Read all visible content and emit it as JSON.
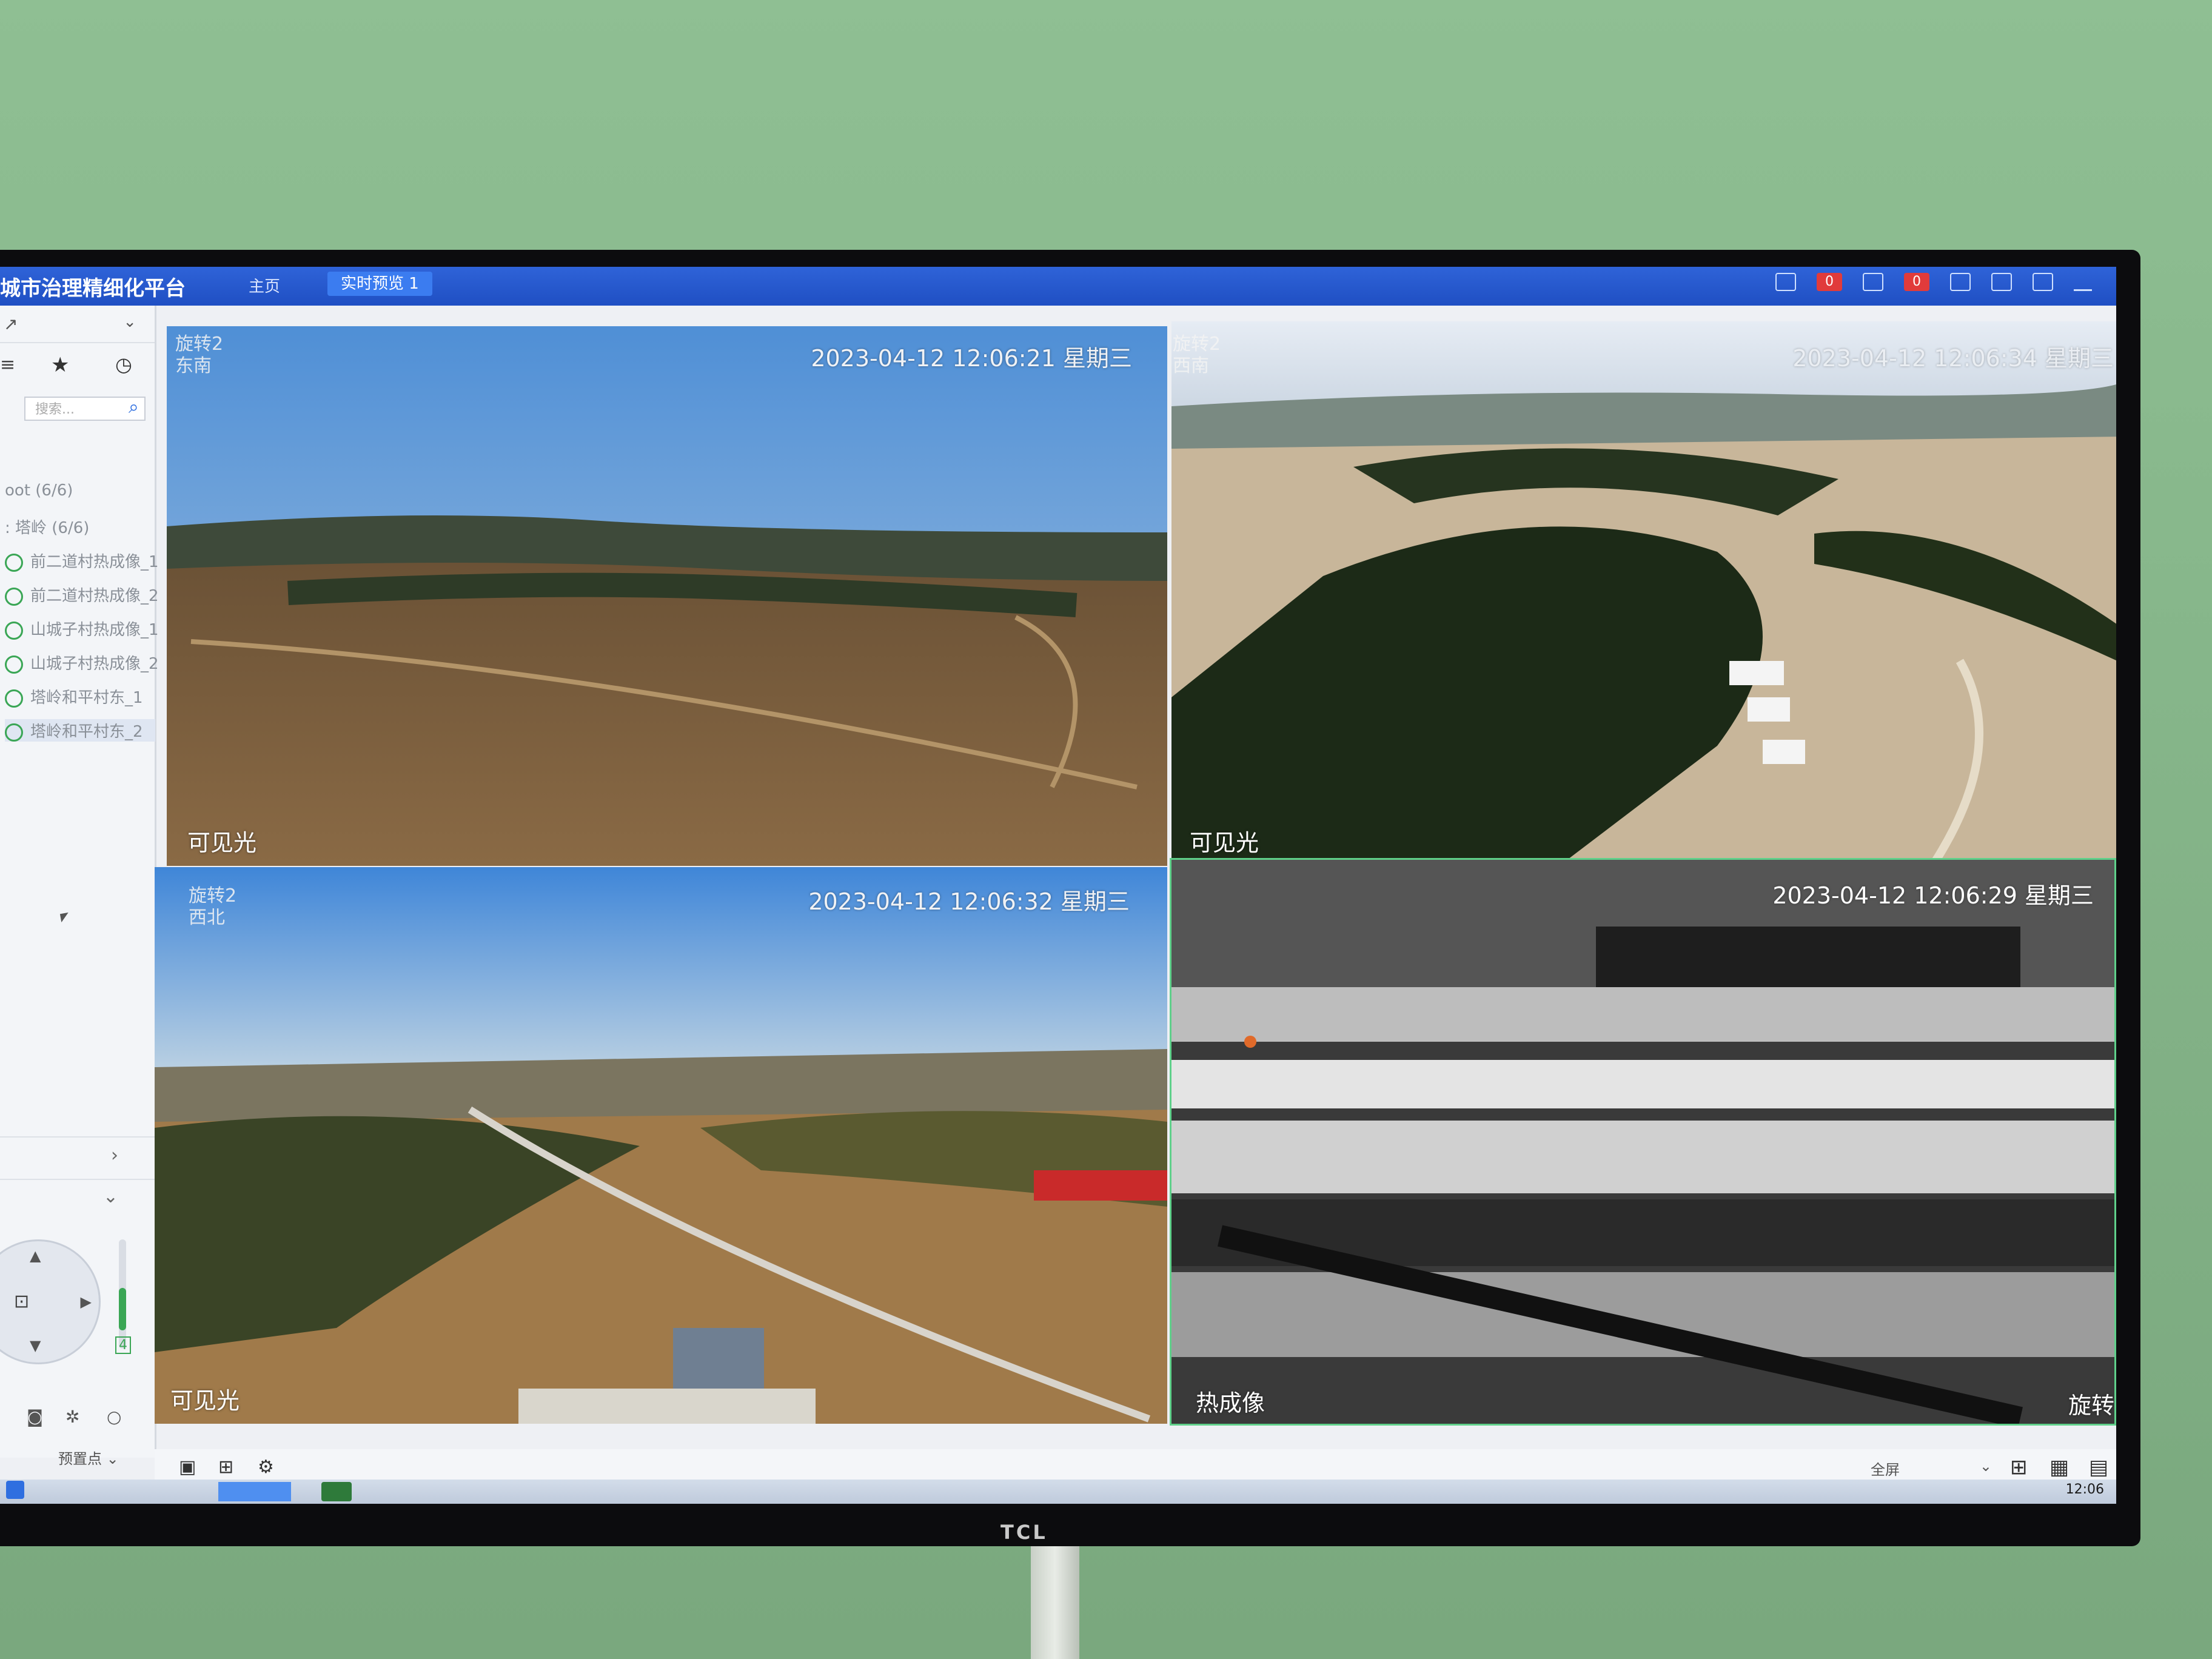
{
  "app": {
    "title": "城市治理精细化平台",
    "tabs": [
      {
        "label": "主页"
      },
      {
        "label": "实时预览 1"
      }
    ],
    "alert_badges": [
      "0",
      "0"
    ]
  },
  "sidebar": {
    "search_placeholder": "搜索...",
    "tree": [
      {
        "label": "oot (6/6)"
      },
      {
        "label": ": 塔岭 (6/6)"
      },
      {
        "label": "前二道村热成像_1"
      },
      {
        "label": "前二道村热成像_2"
      },
      {
        "label": "山城子村热成像_1"
      },
      {
        "label": "山城子村热成像_2"
      },
      {
        "label": "塔岭和平村东_1"
      },
      {
        "label": "塔岭和平村东_2"
      }
    ],
    "ptz_step": "4",
    "preset_label": "预置点"
  },
  "videos": [
    {
      "overlay_line1": "旋转2",
      "overlay_line2": "东南",
      "timestamp": "2023-04-12 12:06:21 星期三",
      "channel_label": "可见光"
    },
    {
      "overlay_line1": "旋转2",
      "overlay_line2": "西南",
      "timestamp": "2023-04-12 12:06:34 星期三",
      "channel_label": "可见光"
    },
    {
      "overlay_line1": "旋转2",
      "overlay_line2": "西北",
      "timestamp": "2023-04-12 12:06:32 星期三",
      "channel_label": "可见光"
    },
    {
      "overlay_line1": "",
      "overlay_line2": "",
      "timestamp": "2023-04-12 12:06:29 星期三",
      "channel_label": "热成像",
      "corner_label": "旋转"
    }
  ],
  "bottom_bar": {
    "view_mode": "全屏"
  },
  "taskbar": {
    "clock": "12:06"
  },
  "tv_brand": "TCL"
}
